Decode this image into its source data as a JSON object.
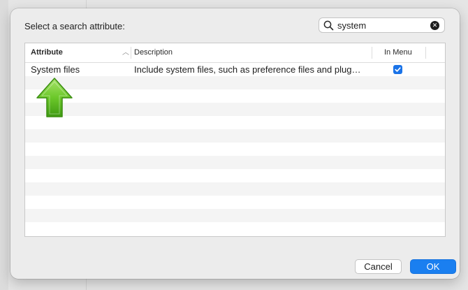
{
  "dialog": {
    "prompt": "Select a search attribute:"
  },
  "search": {
    "value": "system",
    "icon": "magnifier-icon",
    "clear_icon": "clear-icon"
  },
  "table": {
    "columns": {
      "attribute": "Attribute",
      "description": "Description",
      "in_menu": "In Menu"
    },
    "sort": "ascending",
    "rows": [
      {
        "attribute": "System files",
        "description": "Include system files, such as preference files and plug…",
        "in_menu": true
      }
    ]
  },
  "annotation": {
    "icon": "green-up-arrow-icon",
    "color": "#5cbf1f"
  },
  "buttons": {
    "cancel": "Cancel",
    "ok": "OK"
  },
  "colors": {
    "accent": "#1a7ff0",
    "row_alt": "#f4f4f4"
  }
}
